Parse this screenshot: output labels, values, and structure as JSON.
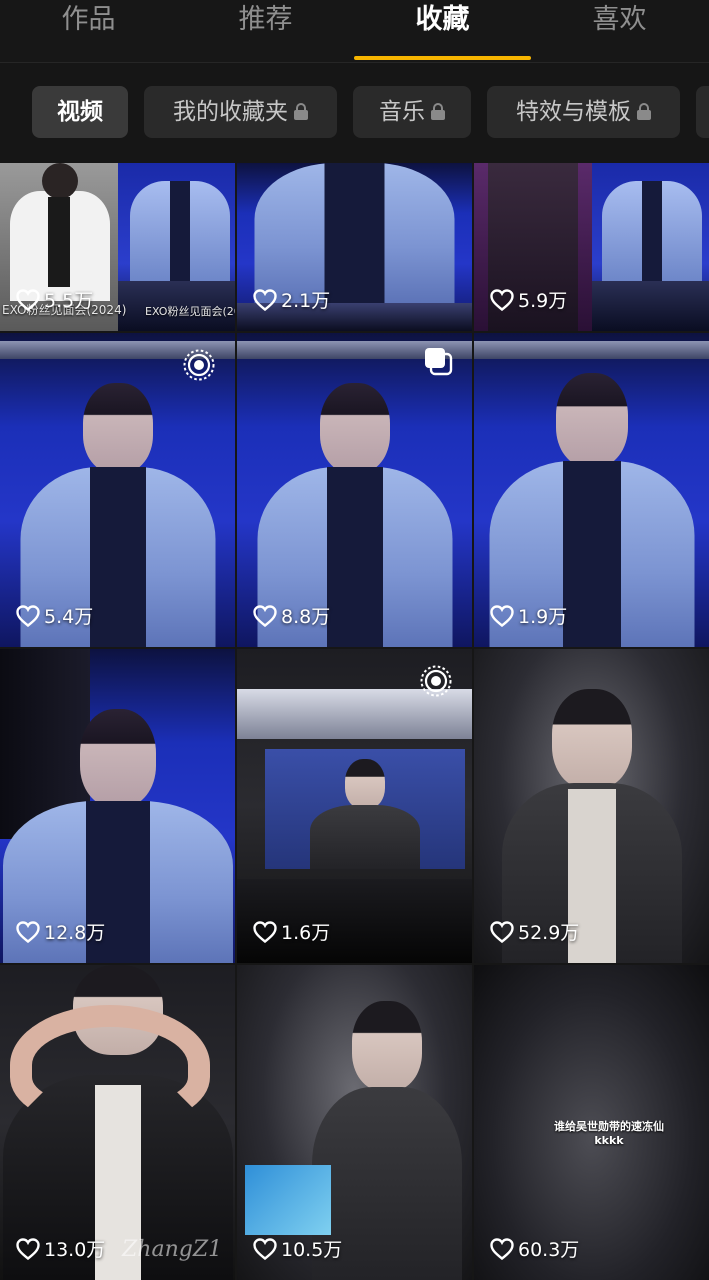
{
  "top_tabs": [
    {
      "label": "作品",
      "active": false
    },
    {
      "label": "推荐",
      "active": false
    },
    {
      "label": "收藏",
      "active": true
    },
    {
      "label": "喜欢",
      "active": false
    }
  ],
  "filter_chips": [
    {
      "label": "视频",
      "active": true,
      "locked": false
    },
    {
      "label": "我的收藏夹",
      "active": false,
      "locked": true
    },
    {
      "label": "音乐",
      "active": false,
      "locked": true
    },
    {
      "label": "特效与模板",
      "active": false,
      "locked": true
    }
  ],
  "accent_color": "#f7b500",
  "videos": [
    {
      "likes": "5.5万",
      "badge": "",
      "overlay_left": "EXO粉丝见面会(2024)",
      "overlay_right": "EXO粉丝见面会(202"
    },
    {
      "likes": "2.1万",
      "badge": ""
    },
    {
      "likes": "5.9万",
      "badge": ""
    },
    {
      "likes": "5.4万",
      "badge": "live-icon"
    },
    {
      "likes": "8.8万",
      "badge": "multi-image-icon"
    },
    {
      "likes": "1.9万",
      "badge": ""
    },
    {
      "likes": "12.8万",
      "badge": ""
    },
    {
      "likes": "1.6万",
      "badge": "live-icon"
    },
    {
      "likes": "52.9万",
      "badge": ""
    },
    {
      "likes": "13.0万",
      "badge": "",
      "watermark": "ZhangZ1"
    },
    {
      "likes": "10.5万",
      "badge": ""
    },
    {
      "likes": "60.3万",
      "badge": "",
      "caption_line1": "谁给吴世勋带的速冻仙",
      "caption_line2": "kkkk"
    }
  ]
}
